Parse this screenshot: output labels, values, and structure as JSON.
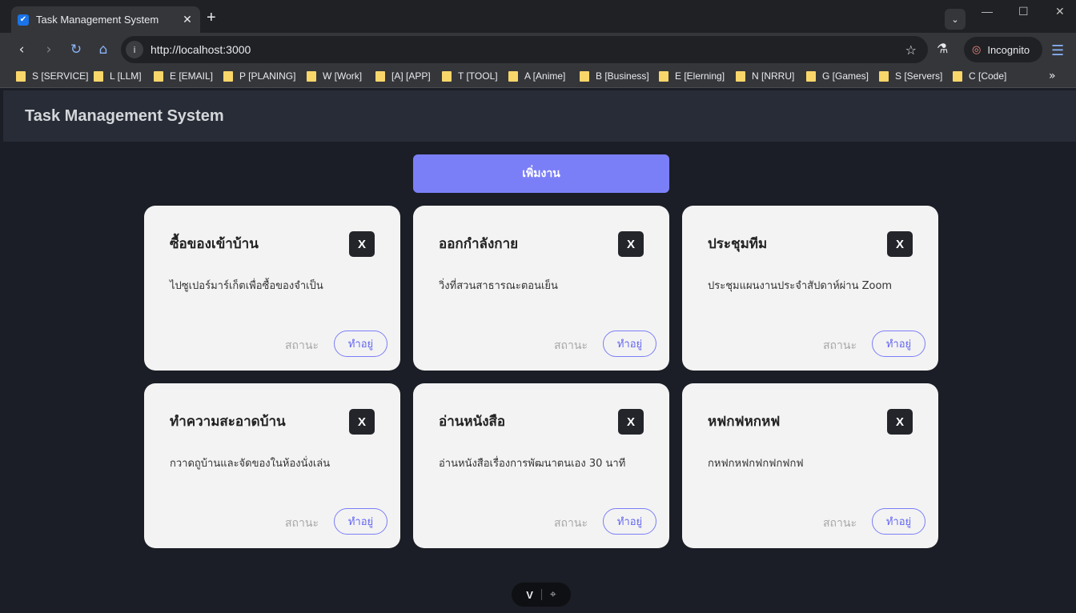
{
  "browser": {
    "tab_title": "Task Management System",
    "new_tab": "+",
    "url": "http://localhost:3000",
    "incognito_label": "Incognito",
    "bookmarks": [
      "S [SERVICE]",
      "L [LLM]",
      "E [EMAIL]",
      "P [PLANING]",
      "W [Work]",
      "[A] [APP]",
      "T [TOOL]",
      "A [Anime]",
      "B [Business]",
      "E [Elerning]",
      "N [NRRU]",
      "G [Games]",
      "S [Servers]",
      "C [Code]"
    ],
    "bookmarks_more": "»"
  },
  "app": {
    "title": "Task Management System",
    "add_button": "เพิ่มงาน",
    "tasks": [
      {
        "title": "ซื้อของเข้าบ้าน",
        "description": "ไปซูเปอร์มาร์เก็ตเพื่อซื้อของจำเป็น",
        "delete": "X",
        "status_label": "สถานะ",
        "status_button": "ทำอยู่"
      },
      {
        "title": "ออกกำลังกาย",
        "description": "วิ่งที่สวนสาธารณะตอนเย็น",
        "delete": "X",
        "status_label": "สถานะ",
        "status_button": "ทำอยู่"
      },
      {
        "title": "ประชุมทีม",
        "description": "ประชุมแผนงานประจำสัปดาห์ผ่าน Zoom",
        "delete": "X",
        "status_label": "สถานะ",
        "status_button": "ทำอยู่"
      },
      {
        "title": "ทำความสะอาดบ้าน",
        "description": "กวาดถูบ้านและจัดของในห้องนั่งเล่น",
        "delete": "X",
        "status_label": "สถานะ",
        "status_button": "ทำอยู่"
      },
      {
        "title": "อ่านหนังสือ",
        "description": "อ่านหนังสือเรื่องการพัฒนาตนเอง 30 นาที",
        "delete": "X",
        "status_label": "สถานะ",
        "status_button": "ทำอยู่"
      },
      {
        "title": "หฟกฟหกหฟ",
        "description": "กหฟกหฟกฟกฟกฟกฟ",
        "delete": "X",
        "status_label": "สถานะ",
        "status_button": "ทำอยู่"
      }
    ]
  },
  "colors": {
    "accent": "#7b7ff7",
    "background": "#1b1e26",
    "card": "#f3f3f3",
    "delete_button": "#23252b"
  }
}
